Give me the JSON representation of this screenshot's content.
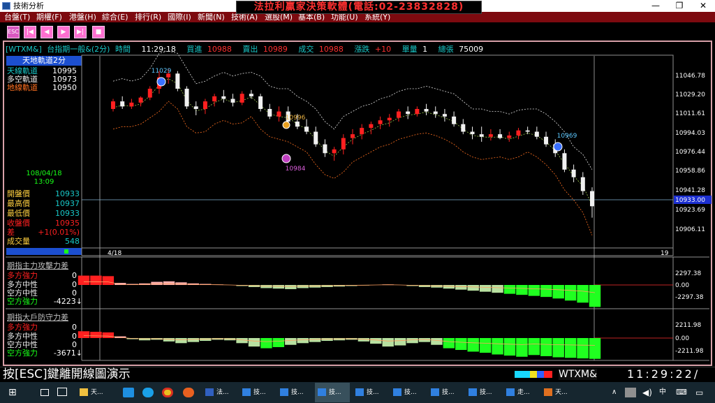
{
  "window": {
    "title": "技術分析",
    "min": "—",
    "max": "❐",
    "close": "✕"
  },
  "banner": "法拉利贏家決策軟體(電話:02-23832828)",
  "menu": [
    "台盤(T)",
    "期權(F)",
    "港盤(H)",
    "綜合(E)",
    "排行(R)",
    "國際(I)",
    "新聞(N)",
    "技術(A)",
    "選股(M)",
    "基本(B)",
    "功能(U)",
    "系統(Y)"
  ],
  "toolbar": {
    "esc_label": "ESC"
  },
  "quote": {
    "symbol": "[WTXM&]",
    "name": "台指期一般&(2分)",
    "time_label": "時間",
    "time": "11:29:18",
    "bid_label": "買進",
    "bid": "10988",
    "ask_label": "賣出",
    "ask": "10989",
    "deal_label": "成交",
    "deal": "10988",
    "chg_label": "漲跌",
    "chg": "+10",
    "vol_label": "單量",
    "vol": "1",
    "total_label": "總張",
    "total": "75009"
  },
  "indicator": {
    "title": "天地軌道2分",
    "rows": [
      {
        "label": "天線軌道",
        "value": "10995",
        "color": "#18c8c8"
      },
      {
        "label": "多空軌道",
        "value": "10973",
        "color": "#f0f0f0"
      },
      {
        "label": "地線軌道",
        "value": "10950",
        "color": "#ff7020"
      }
    ]
  },
  "datetime": {
    "date": "108/04/18",
    "time": "13:09"
  },
  "ohlc": [
    {
      "label": "開盤價",
      "value": "10933",
      "color": "#18c8c8"
    },
    {
      "label": "最高價",
      "value": "10937",
      "color": "#18c8c8"
    },
    {
      "label": "最低價",
      "value": "10933",
      "color": "#18c8c8"
    },
    {
      "label": "收盤價",
      "value": "10935",
      "color": "#ff2020"
    },
    {
      "label": "差",
      "value": "+1(0.01%)",
      "color": "#ff2020"
    },
    {
      "label": "成交量",
      "value": "548",
      "color": "#18c8c8"
    }
  ],
  "main_axis": {
    "ticks": [
      "11046.78",
      "11029.20",
      "11011.61",
      "10994.03",
      "10976.44",
      "10958.86",
      "10941.28",
      "10923.69",
      "10906.11"
    ],
    "current": "10933.00",
    "x_left": "4/18",
    "x_right": "19"
  },
  "annotations": [
    {
      "text": "11029",
      "color": "#5cc8ff"
    },
    {
      "text": "10996",
      "color": "#e8b040"
    },
    {
      "text": "10984",
      "color": "#e060e0"
    },
    {
      "text": "10969",
      "color": "#5cc8ff"
    }
  ],
  "panel1": {
    "title": "期指主力攻擊力差",
    "rows": [
      {
        "label": "多方強力",
        "value": "0",
        "color": "#ff2020"
      },
      {
        "label": "多方中性",
        "value": "0",
        "color": "#f0f0f0"
      },
      {
        "label": "空方中性",
        "value": "0",
        "color": "#f0f0f0"
      },
      {
        "label": "空方強力",
        "value": "-4223↓",
        "color": "#18ff18"
      }
    ],
    "ticks": [
      "2297.38",
      "0.00",
      "-2297.38"
    ]
  },
  "panel2": {
    "title": "期指大戶防守力差",
    "rows": [
      {
        "label": "多方強力",
        "value": "0",
        "color": "#ff2020"
      },
      {
        "label": "多方中性",
        "value": "0",
        "color": "#f0f0f0"
      },
      {
        "label": "空方中性",
        "value": "0",
        "color": "#f0f0f0"
      },
      {
        "label": "空方強力",
        "value": "-3671↓",
        "color": "#18ff18"
      }
    ],
    "ticks": [
      "2211.98",
      "0.00",
      "-2211.98"
    ]
  },
  "status": {
    "hint": "按[ESC]鍵離開線圖演示",
    "symbol": "WTXM&",
    "clock": "11:29:22/"
  },
  "taskbar": {
    "items": [
      "天...",
      "法...",
      "技...",
      "技...",
      "技...",
      "技...",
      "技...",
      "技...",
      "技...",
      "走...",
      "天..."
    ]
  },
  "chart_data": {
    "type": "candlestick",
    "ylim": [
      10900,
      11052
    ],
    "candles": [
      [
        11010,
        11018,
        11008,
        11016
      ],
      [
        11016,
        11020,
        11010,
        11012
      ],
      [
        11012,
        11018,
        11010,
        11015
      ],
      [
        11015,
        11020,
        11012,
        11019
      ],
      [
        11019,
        11028,
        11017,
        11026
      ],
      [
        11026,
        11040,
        11022,
        11035
      ],
      [
        11035,
        11042,
        11030,
        11038
      ],
      [
        11038,
        11040,
        11024,
        11026
      ],
      [
        11026,
        11028,
        11010,
        11012
      ],
      [
        11012,
        11016,
        11005,
        11010
      ],
      [
        11010,
        11018,
        11006,
        11016
      ],
      [
        11016,
        11022,
        11012,
        11020
      ],
      [
        11020,
        11025,
        11015,
        11018
      ],
      [
        11018,
        11022,
        11012,
        11015
      ],
      [
        11015,
        11024,
        11013,
        11022
      ],
      [
        11022,
        11025,
        11018,
        11020
      ],
      [
        11020,
        11022,
        11008,
        11010
      ],
      [
        11010,
        11014,
        11002,
        11004
      ],
      [
        11004,
        11012,
        11000,
        11008
      ],
      [
        11008,
        11012,
        10998,
        11000
      ],
      [
        11000,
        11006,
        10994,
        10996
      ],
      [
        10996,
        11002,
        10990,
        10992
      ],
      [
        10992,
        10996,
        10980,
        10982
      ],
      [
        10982,
        10986,
        10972,
        10975
      ],
      [
        10975,
        10980,
        10969,
        10978
      ],
      [
        10978,
        10990,
        10974,
        10987
      ],
      [
        10987,
        10994,
        10982,
        10990
      ],
      [
        10990,
        10998,
        10986,
        10995
      ],
      [
        10995,
        11000,
        10990,
        10998
      ],
      [
        10998,
        11004,
        10994,
        11001
      ],
      [
        11001,
        11006,
        10996,
        11003
      ],
      [
        11003,
        11010,
        11000,
        11008
      ],
      [
        11008,
        11012,
        11002,
        11006
      ],
      [
        11006,
        11012,
        11004,
        11010
      ],
      [
        11010,
        11014,
        11005,
        11008
      ],
      [
        11008,
        11012,
        11003,
        11006
      ],
      [
        11006,
        11010,
        11000,
        11004
      ],
      [
        11004,
        11008,
        10996,
        10998
      ],
      [
        10998,
        11002,
        10990,
        10992
      ],
      [
        10992,
        10996,
        10986,
        10990
      ],
      [
        10990,
        10996,
        10984,
        10988
      ],
      [
        10988,
        10994,
        10985,
        10990
      ],
      [
        10990,
        10994,
        10986,
        10987
      ],
      [
        10987,
        10992,
        10984,
        10989
      ],
      [
        10989,
        10995,
        10986,
        10993
      ],
      [
        10993,
        10996,
        10990,
        10992
      ],
      [
        10992,
        10996,
        10986,
        10988
      ],
      [
        10988,
        10992,
        10980,
        10982
      ],
      [
        10982,
        10986,
        10972,
        10975
      ],
      [
        10975,
        10978,
        10960,
        10962
      ],
      [
        10962,
        10966,
        10952,
        10956
      ],
      [
        10956,
        10960,
        10942,
        10945
      ],
      [
        10945,
        10948,
        10924,
        10933
      ]
    ],
    "panel1_values": [
      1800,
      1800,
      1700,
      400,
      200,
      300,
      600,
      700,
      500,
      300,
      200,
      100,
      0,
      -200,
      -400,
      -600,
      -700,
      -800,
      -600,
      -500,
      -400,
      -300,
      -200,
      -100,
      0,
      100,
      0,
      -200,
      -400,
      -500,
      -700,
      -900,
      -1100,
      -1300,
      -1500,
      -1700,
      -1900,
      -2100,
      -2300,
      -2600,
      -3000,
      -3400,
      -4223
    ],
    "panel2_values": [
      1200,
      1100,
      1000,
      300,
      -200,
      -400,
      -300,
      -600,
      -900,
      -700,
      -500,
      -300,
      -400,
      -900,
      -1500,
      -1800,
      -1600,
      -1200,
      -900,
      -700,
      -500,
      -400,
      -300,
      -600,
      -1000,
      -1500,
      -1300,
      -900,
      -700,
      -1200,
      -1800,
      -2100,
      -2400,
      -2600,
      -2900,
      -3100,
      -3300,
      -3000,
      -3200,
      -3400,
      -3500,
      -3600,
      -3671
    ]
  }
}
